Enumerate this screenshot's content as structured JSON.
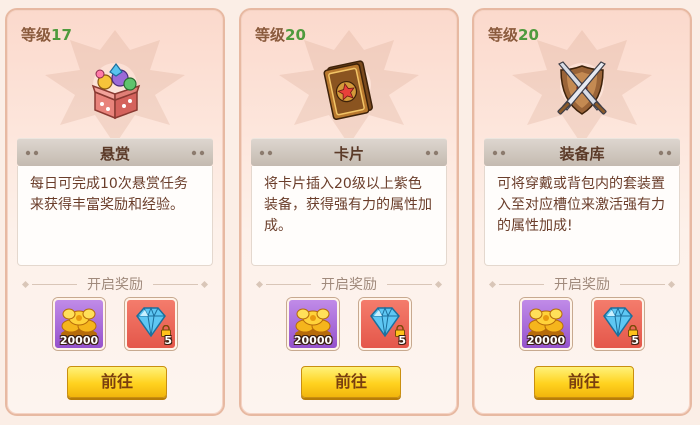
{
  "cards": [
    {
      "level_label": "等级",
      "level_value": "17",
      "icon": "gift-box-icon",
      "title": "悬赏",
      "description": "每日可完成10次悬赏任务来获得丰富奖励和经验。",
      "rewards_label": "开启奖励",
      "rewards": [
        {
          "icon": "gold-coins-icon",
          "count": "20000"
        },
        {
          "icon": "diamond-icon",
          "count": "5",
          "locked": true
        }
      ],
      "button_label": "前往"
    },
    {
      "level_label": "等级",
      "level_value": "20",
      "icon": "card-icon",
      "title": "卡片",
      "description": "将卡片插入20级以上紫色装备，获得强有力的属性加成。",
      "rewards_label": "开启奖励",
      "rewards": [
        {
          "icon": "gold-coins-icon",
          "count": "20000"
        },
        {
          "icon": "diamond-icon",
          "count": "5",
          "locked": true
        }
      ],
      "button_label": "前往"
    },
    {
      "level_label": "等级",
      "level_value": "20",
      "icon": "crossed-swords-shield-icon",
      "title": "装备库",
      "description": "可将穿戴或背包内的套装置入至对应槽位来激活强有力的属性加成!",
      "rewards_label": "开启奖励",
      "rewards": [
        {
          "icon": "gold-coins-icon",
          "count": "20000"
        },
        {
          "icon": "diamond-icon",
          "count": "5",
          "locked": true
        }
      ],
      "button_label": "前往"
    }
  ],
  "colors": {
    "level_number": "#4f9a3d",
    "title_bar": "#c4bab0",
    "button": "#ffd21f",
    "gold_reward_bg": "#9552cc",
    "gem_reward_bg": "#e4574a"
  }
}
